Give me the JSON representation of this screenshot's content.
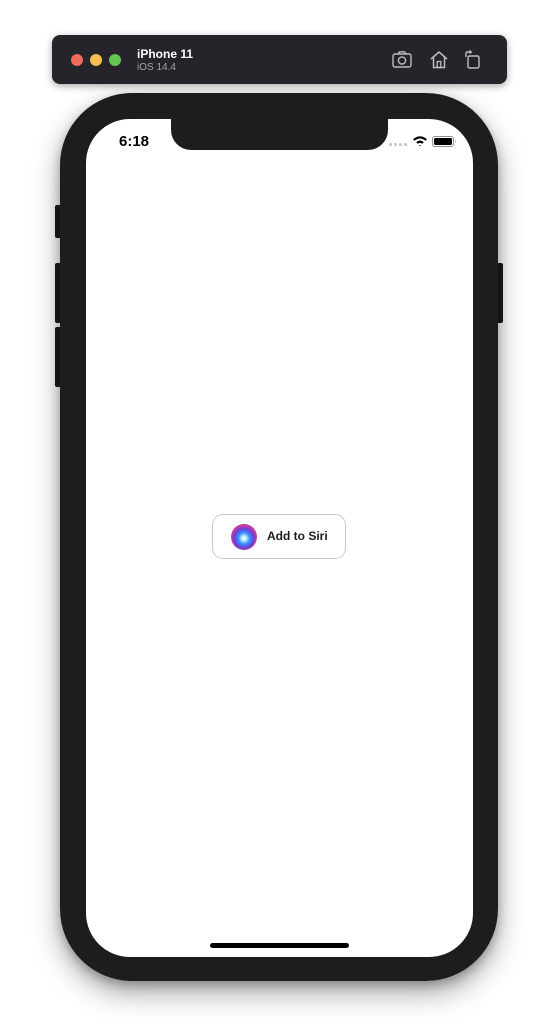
{
  "toolbar": {
    "device_name": "iPhone 11",
    "os_version": "iOS 14.4",
    "buttons": [
      "screenshot-icon",
      "home-icon",
      "rotate-icon"
    ]
  },
  "status_bar": {
    "time": "6:18",
    "icons": [
      "cellular-signal-icon",
      "wifi-icon",
      "battery-icon"
    ]
  },
  "main": {
    "siri_button": {
      "label": "Add to Siri",
      "icon": "siri-icon"
    }
  },
  "colors": {
    "toolbar_bg": "#26242b",
    "close": "#ed6a5e",
    "minimize": "#f5bf4f",
    "zoom": "#62c554",
    "frame": "#1d1d1f",
    "screen_bg": "#ffffff",
    "button_border": "#c8c8cc"
  }
}
